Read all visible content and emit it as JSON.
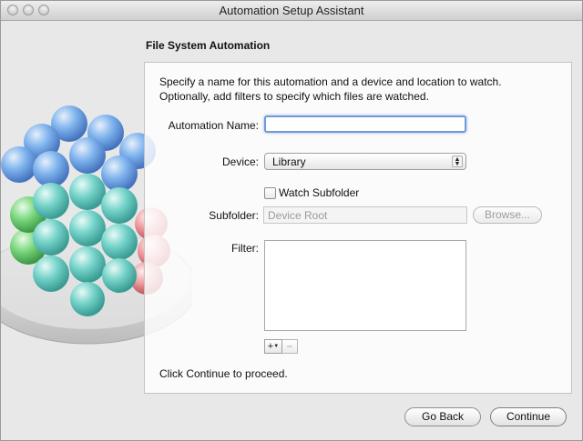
{
  "window": {
    "title": "Automation Setup Assistant"
  },
  "section": {
    "title": "File System Automation"
  },
  "description": {
    "line1": "Specify a name for this automation and a device and location to watch.",
    "line2": "Optionally, add filters to specify which files are watched."
  },
  "form": {
    "name_label": "Automation Name:",
    "name_value": "",
    "device_label": "Device:",
    "device_value": "Library",
    "watch_subfolder_label": "Watch Subfolder",
    "watch_subfolder_checked": false,
    "subfolder_label": "Subfolder:",
    "subfolder_value": "Device Root",
    "browse_label": "Browse...",
    "filter_label": "Filter:",
    "add_label": "+",
    "remove_label": "−"
  },
  "hint": "Click Continue to proceed.",
  "footer": {
    "back_label": "Go Back",
    "continue_label": "Continue"
  },
  "icons": [
    "close-icon",
    "minimize-icon",
    "zoom-icon",
    "up-down-arrows-icon",
    "add-menu-caret-icon"
  ],
  "colors": {
    "focus_ring": "#6f9bd6",
    "window_bg": "#e8e8e8"
  }
}
